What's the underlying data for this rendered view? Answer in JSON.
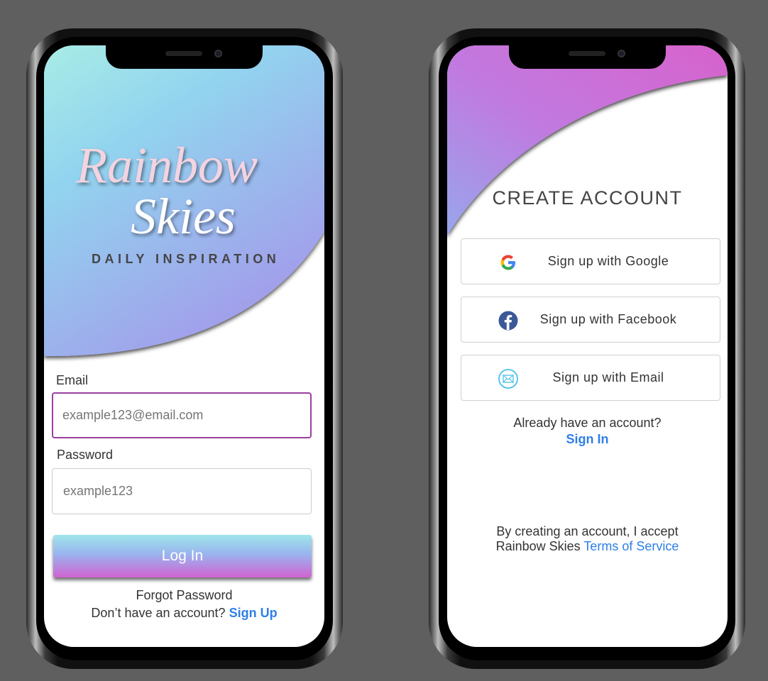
{
  "login_screen": {
    "logo": {
      "line1": "Rainbow",
      "line2": "Skies",
      "tagline": "DAILY INSPIRATION"
    },
    "email": {
      "label": "Email",
      "placeholder": "example123@email.com"
    },
    "password": {
      "label": "Password",
      "placeholder": "example123"
    },
    "login_button": "Log In",
    "forgot_password": "Forgot Password",
    "signup_prompt": "Don’t have an account?",
    "signup_link": "Sign Up"
  },
  "signup_screen": {
    "title": "CREATE ACCOUNT",
    "buttons": [
      {
        "label": "Sign up with Google",
        "icon": "google-icon"
      },
      {
        "label": "Sign up with Facebook",
        "icon": "facebook-icon"
      },
      {
        "label": "Sign up with Email",
        "icon": "email-icon"
      }
    ],
    "signin_prompt": "Already have an account?",
    "signin_link": "Sign In",
    "terms_line1": "By creating an account, I accept",
    "terms_line2_prefix": "Rainbow Skies",
    "terms_link": "Terms of Service"
  },
  "colors": {
    "accent": "#2f7fe6",
    "focus_border": "#9b3fa0"
  }
}
